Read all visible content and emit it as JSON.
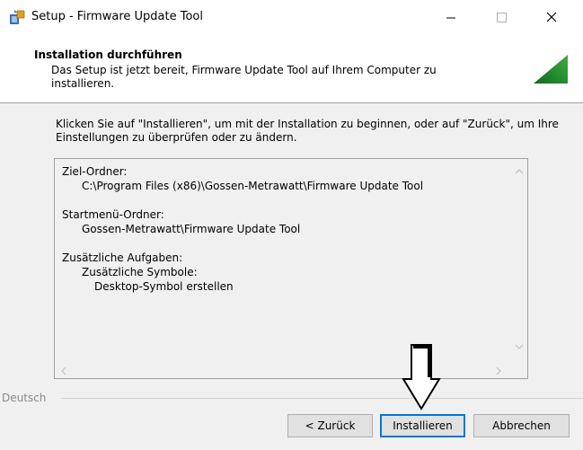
{
  "window": {
    "title": "Setup - Firmware Update Tool",
    "controls": {
      "minimize": "—",
      "maximize": "☐",
      "close": "✕"
    }
  },
  "header": {
    "title": "Installation durchführen",
    "description": "Das Setup ist jetzt bereit, Firmware Update Tool auf Ihrem Computer zu installieren."
  },
  "intro": "Klicken Sie auf \"Installieren\", um mit der Installation zu beginnen, oder auf \"Zurück\", um Ihre Einstellungen zu überprüfen oder zu ändern.",
  "memo": {
    "dest_label": "Ziel-Ordner:",
    "dest_value": "C:\\Program Files (x86)\\Gossen-Metrawatt\\Firmware Update Tool",
    "start_label": "Startmenü-Ordner:",
    "start_value": "Gossen-Metrawatt\\Firmware Update Tool",
    "tasks_label": "Zusätzliche Aufgaben:",
    "tasks_sub": "Zusätzliche Symbole:",
    "tasks_item": "Desktop-Symbol erstellen"
  },
  "language": "Deutsch",
  "buttons": {
    "back": "< Zurück",
    "install": "Installieren",
    "cancel": "Abbrechen"
  },
  "icons": {
    "app": "installer-icon",
    "logo": "green-triangle-logo",
    "cursor": "arrow-cursor-icon"
  }
}
